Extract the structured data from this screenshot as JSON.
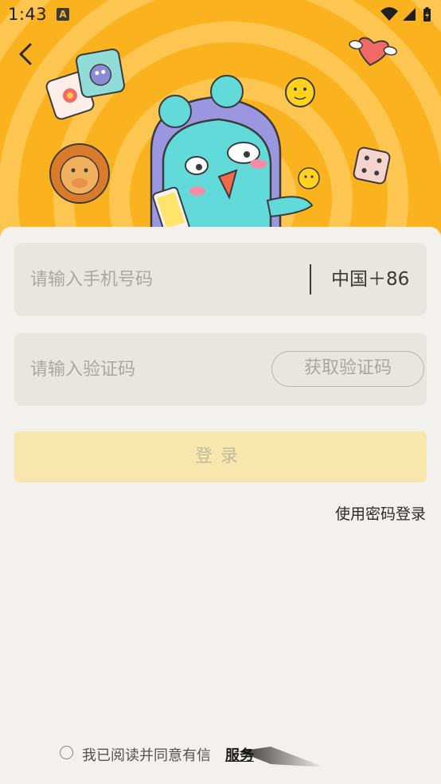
{
  "status_bar": {
    "time": "1:43",
    "notification_icon": "A"
  },
  "header": {
    "back_icon": "chevron-left-icon"
  },
  "login_form": {
    "phone_placeholder": "请输入手机号码",
    "country_code": "中国＋86",
    "code_placeholder": "请输入验证码",
    "get_code_label": "获取验证码",
    "login_label": "登录",
    "password_login_label": "使用密码登录"
  },
  "agreement": {
    "text": "我已阅读并同意有信",
    "link": "服务"
  },
  "colors": {
    "hero_background": "#fbb21f",
    "login_button": "#f7e7ae",
    "field_background": "#e9e6e1",
    "page_background": "#f3f1ee"
  }
}
